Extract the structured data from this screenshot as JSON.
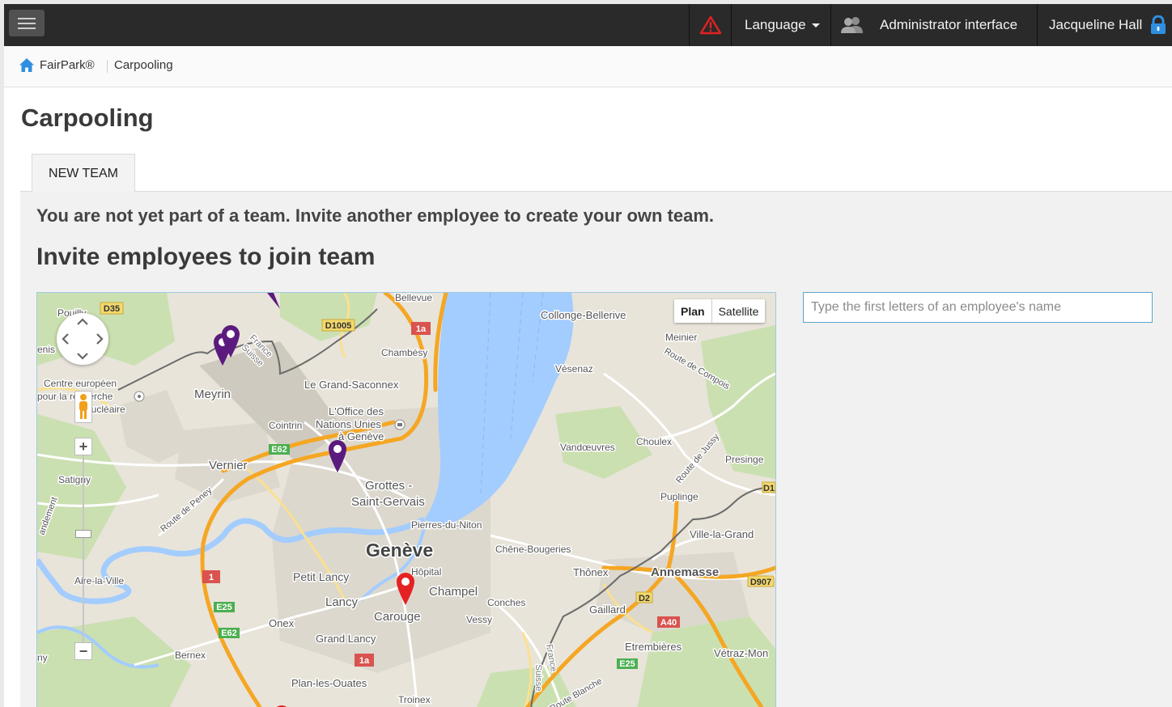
{
  "topbar": {
    "language_label": "Language",
    "admin_label": "Administrator interface",
    "user_name": "Jacqueline Hall"
  },
  "breadcrumb": {
    "home": "FairPark®",
    "current": "Carpooling"
  },
  "page": {
    "title": "Carpooling",
    "tab_label": "NEW TEAM",
    "message": "You are not yet part of a team. Invite another employee to create your own team.",
    "section_title": "Invite employees to join team"
  },
  "search": {
    "placeholder": "Type the first letters of an employee's name",
    "value": ""
  },
  "map": {
    "type_plan": "Plan",
    "type_satellite": "Satellite",
    "zoom_in": "+",
    "zoom_out": "−",
    "labels": {
      "bellevue": "Bellevue",
      "pouilly": "Pouilly",
      "d35": "D35",
      "d1005": "D1005",
      "r1a_top": "1a",
      "collonge": "Collonge-Bellerive",
      "meinier": "Meinier",
      "route_compois": "Route de Compois",
      "france_suisse_1": "France",
      "france_suisse_2": "Suisse",
      "chambesy": "Chambésy",
      "vesenaz": "Vésenaz",
      "genis": "enis",
      "centre_europeen": "Centre européen",
      "pour_la_recherche": "pour la recherche",
      "nucleaire": "nucléaire",
      "meyrin": "Meyrin",
      "grand_saconnex": "Le Grand-Saconnex",
      "office": "L'Office des",
      "nations_unies": "Nations Unies",
      "a_geneve": "à Genève",
      "cointrin": "Cointrin",
      "e62_a": "E62",
      "vandoeuvres": "Vandœuvres",
      "choulex": "Choulex",
      "route_jussy": "Route de Jussy",
      "presinge": "Presinge",
      "vernier": "Vernier",
      "satigny": "Satigny",
      "grottes": "Grottes -",
      "saint_gervais": "Saint-Gervais",
      "puplinge": "Puplinge",
      "d1": "D1",
      "route_peney": "Route de Peney",
      "pierres_niton": "Pierres-du-Niton",
      "ville_la_grand": "Ville-la-Grand",
      "geneve": "Genève",
      "chene_bougeries": "Chêne-Bougeries",
      "hopital": "Hôpital",
      "aire_la_ville": "Aire-la-Ville",
      "r1": "1",
      "petit_lancy": "Petit Lancy",
      "thonex": "Thônex",
      "annemasse": "Annemasse",
      "d907": "D907",
      "champel": "Champel",
      "conches": "Conches",
      "lancy": "Lancy",
      "e25_a": "E25",
      "d2": "D2",
      "gaillard": "Gaillard",
      "carouge": "Carouge",
      "vessy": "Vessy",
      "onex": "Onex",
      "a40": "A40",
      "e62_b": "E62",
      "grand_lancy": "Grand Lancy",
      "etrembieres": "Etrembières",
      "ny": "ny",
      "bernex": "Bernex",
      "r1a_bottom": "1a",
      "suisse_v": "Suisse",
      "france_v": "France",
      "e25_b": "E25",
      "vetraz": "Vétraz-Mon",
      "plan_ouates": "Plan-les-Ouates",
      "route_blanche": "Route Blanche",
      "troinex": "Troinex",
      "andement": "andement"
    },
    "colors": {
      "land": "#e8e4da",
      "water": "#a3ccff",
      "highway": "#f5a623",
      "road": "#ffffff",
      "green": "#c6dfa9",
      "marker_team": "#5b1a7e",
      "marker_self": "#e52222"
    }
  },
  "icons": {
    "menu": "menu-icon",
    "warning": "warning-icon",
    "users": "users-icon",
    "lock": "lock-icon",
    "home": "home-icon"
  }
}
